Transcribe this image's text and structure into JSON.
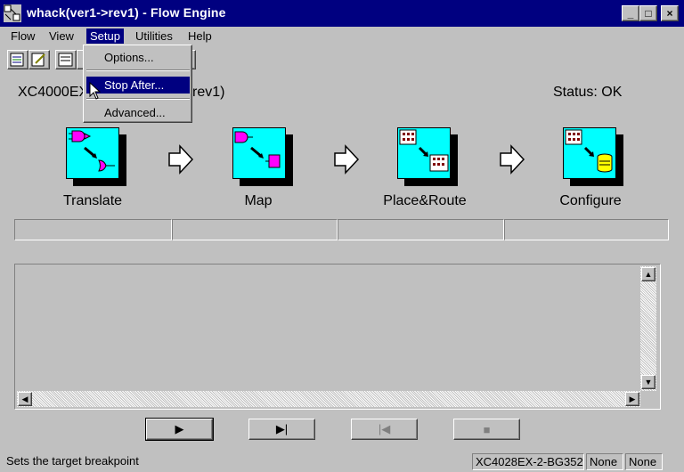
{
  "window": {
    "title": "whack(ver1->rev1) - Flow Engine",
    "buttons": {
      "minimize": "_",
      "maximize": "□",
      "close": "×"
    }
  },
  "menubar": {
    "items": [
      {
        "label": "Flow",
        "mnemonic": "F"
      },
      {
        "label": "View",
        "mnemonic": "V"
      },
      {
        "label": "Setup",
        "mnemonic": "S"
      },
      {
        "label": "Utilities",
        "mnemonic": "U"
      },
      {
        "label": "Help",
        "mnemonic": "H"
      }
    ],
    "open_menu": "Setup"
  },
  "setup_menu": {
    "items": [
      {
        "label": "Options..."
      },
      {
        "label": "Stop After..."
      },
      {
        "label": "Advanced..."
      }
    ],
    "highlighted": "Stop After..."
  },
  "main": {
    "device_prefix": "XC4000EX",
    "device_suffix": "rev1)",
    "status": "Status: OK",
    "steps": [
      {
        "label": "Translate",
        "icon": "translate-icon"
      },
      {
        "label": "Map",
        "icon": "map-icon"
      },
      {
        "label": "Place&Route",
        "icon": "place-route-icon"
      },
      {
        "label": "Configure",
        "icon": "configure-icon"
      }
    ]
  },
  "controls": {
    "run": "▶",
    "step": "▶|",
    "previous": "|◀",
    "stop": "■"
  },
  "statusbar": {
    "message": "Sets the target breakpoint",
    "device": "XC4028EX-2-BG352",
    "field2": "None",
    "field3": "None"
  },
  "colors": {
    "titlebar": "#000080",
    "icon_face": "#00ffff",
    "chip": "#ff00ff"
  }
}
